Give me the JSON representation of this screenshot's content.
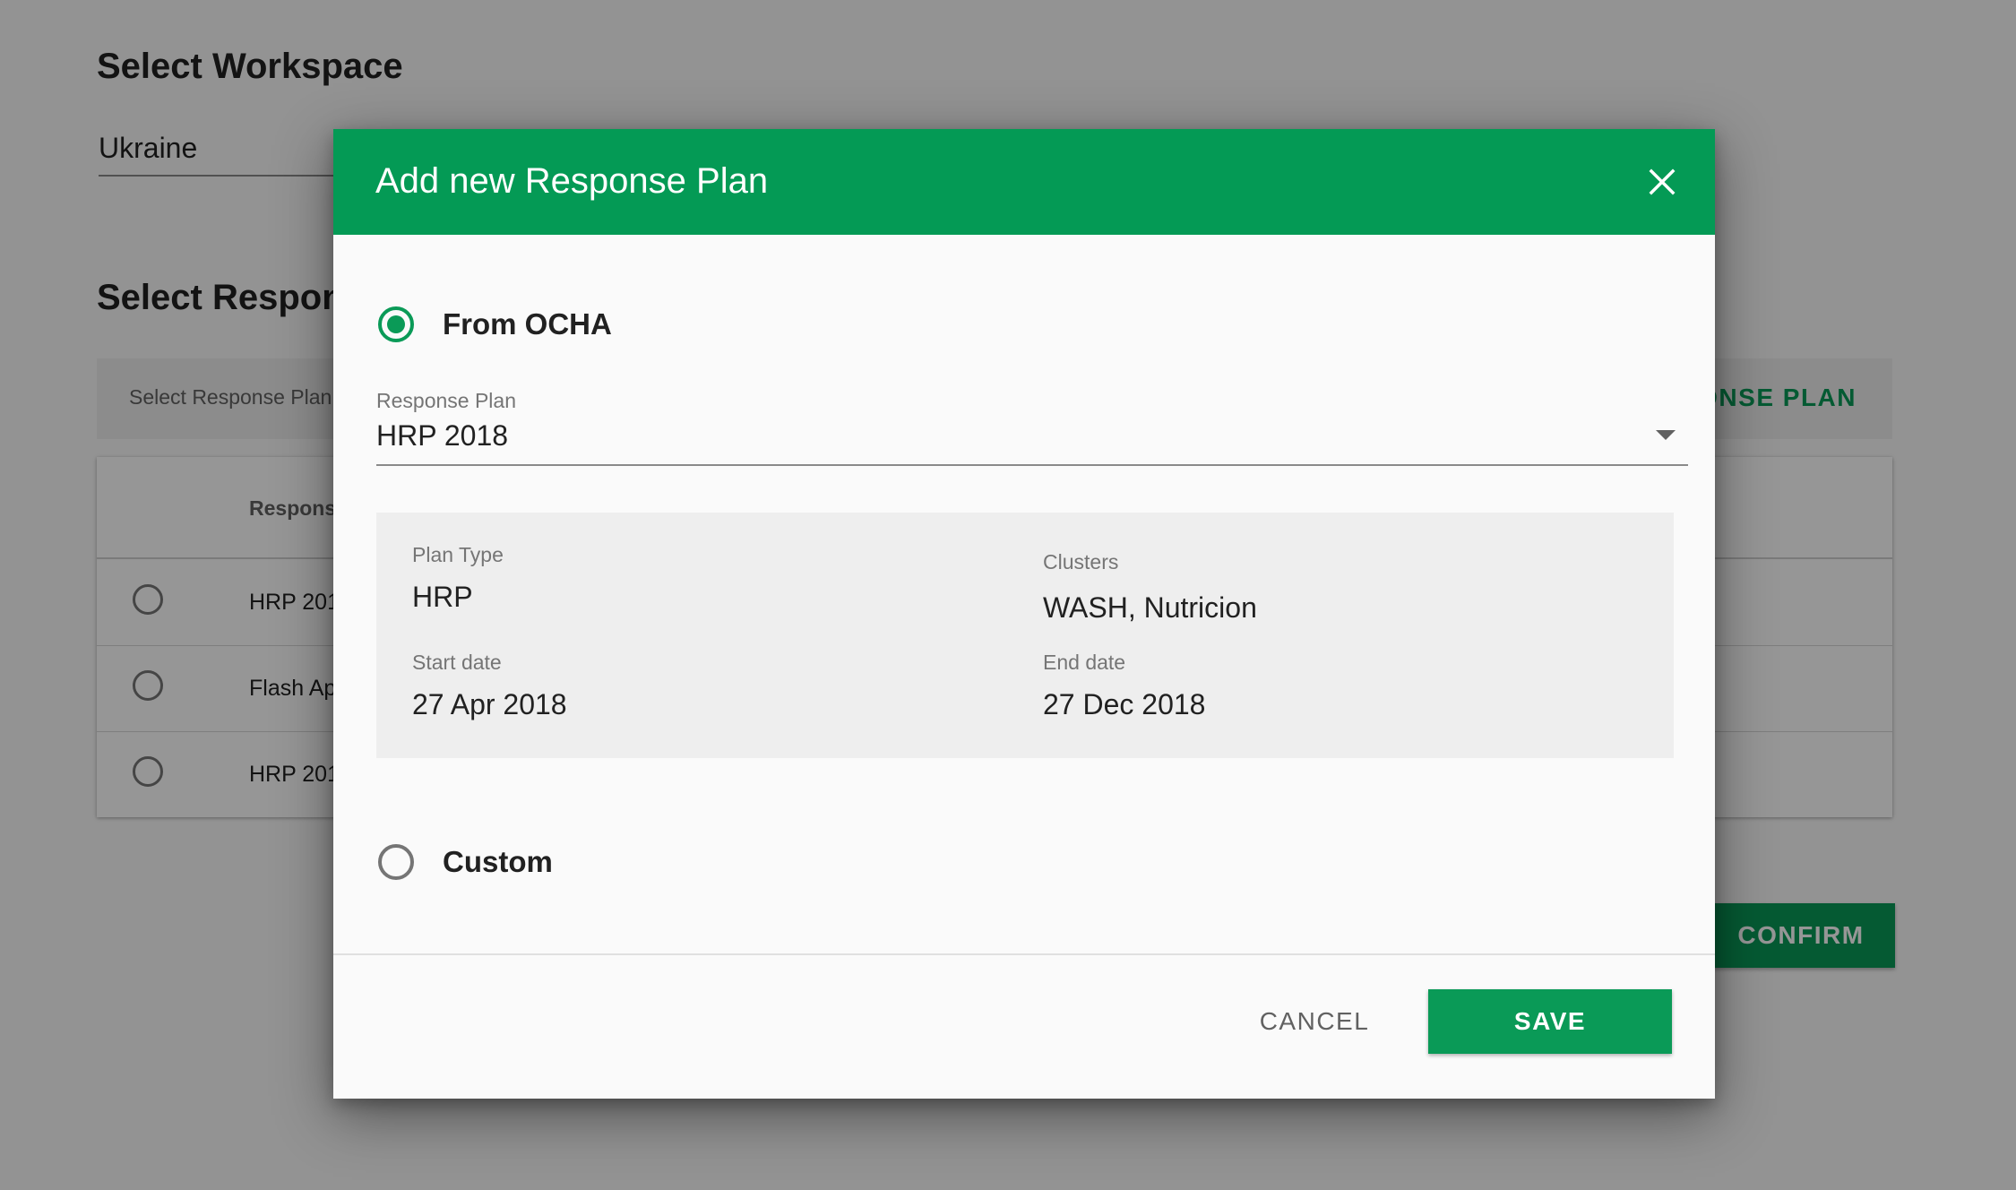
{
  "background": {
    "workspace_heading": "Select Workspace",
    "workspace_value": "Ukraine",
    "response_plan_heading": "Select Respons",
    "filter_placeholder": "Select Response Plan",
    "add_plan_link": "ONSE PLAN",
    "table": {
      "column_header": "Respons",
      "rows": [
        {
          "name": "HRP 201"
        },
        {
          "name": "Flash Ap"
        },
        {
          "name": "HRP 201"
        }
      ]
    },
    "confirm_label": "CONFIRM"
  },
  "dialog": {
    "title": "Add new Response Plan",
    "close_icon": "close-icon",
    "options": {
      "ocha_label": "From OCHA",
      "ocha_selected": true,
      "custom_label": "Custom",
      "custom_selected": false
    },
    "response_plan_field": {
      "label": "Response Plan",
      "value": "HRP 2018"
    },
    "details": {
      "plan_type_label": "Plan Type",
      "plan_type_value": "HRP",
      "clusters_label": "Clusters",
      "clusters_value": "WASH, Nutricion",
      "start_date_label": "Start date",
      "start_date_value": "27 Apr 2018",
      "end_date_label": "End date",
      "end_date_value": "27 Dec 2018"
    },
    "footer": {
      "cancel_label": "CANCEL",
      "save_label": "SAVE"
    }
  },
  "colors": {
    "brand_green": "#049a55",
    "button_green": "#0a9a57",
    "scrim": "rgba(0,0,0,0.41)"
  }
}
